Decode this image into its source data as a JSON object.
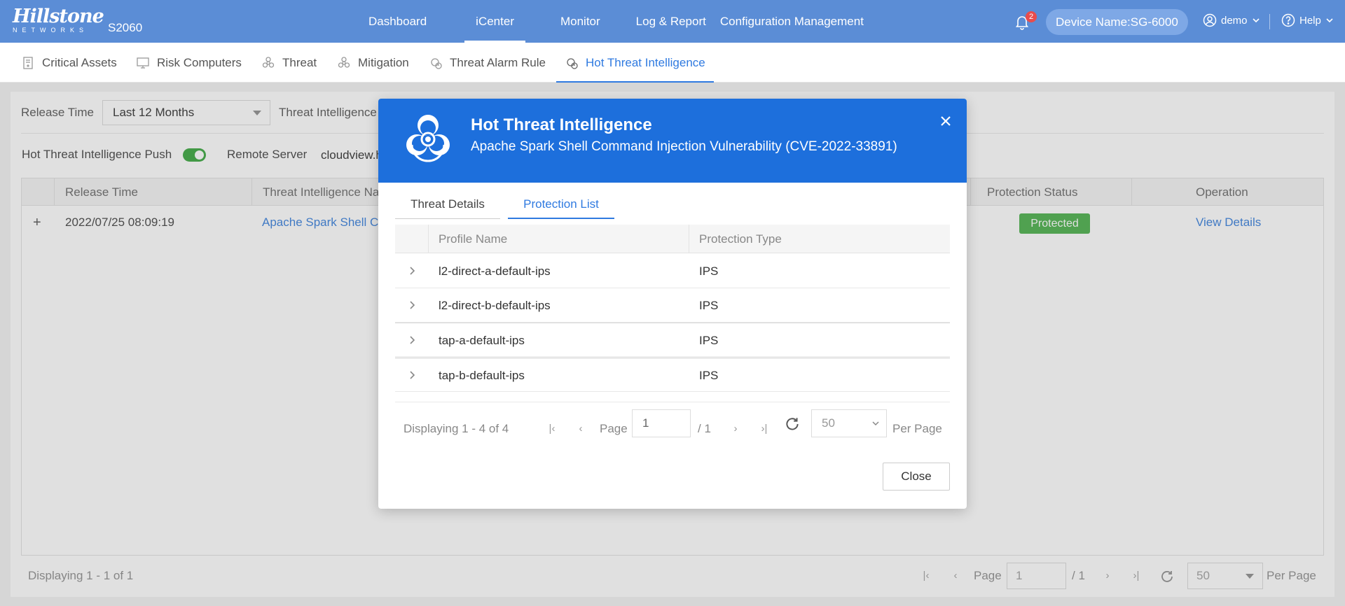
{
  "header": {
    "brand": "Hillstone",
    "brand_sub": "NETWORKS",
    "model": "S2060",
    "nav": [
      "Dashboard",
      "iCenter",
      "Monitor",
      "Log & Report",
      "Configuration Management"
    ],
    "active_nav": "iCenter",
    "notification_count": "2",
    "device_name": "Device Name:SG-6000",
    "user": "demo",
    "help": "Help",
    "colors": {
      "bar": "#5b8dd6",
      "badge": "#e84c4c"
    }
  },
  "subnav": {
    "tabs": [
      "Critical Assets",
      "Risk Computers",
      "Threat",
      "Mitigation",
      "Threat Alarm Rule",
      "Hot Threat Intelligence"
    ],
    "active": "Hot Threat Intelligence"
  },
  "filters": {
    "release_time_label": "Release Time",
    "release_time_value": "Last 12 Months",
    "threat_intel_label": "Threat Intelligence",
    "push_label": "Hot Threat Intelligence Push",
    "push_enabled": true,
    "remote_server_label": "Remote Server",
    "remote_server_value": "cloudview.h"
  },
  "grid": {
    "headers": [
      "Release Time",
      "Threat Intelligence Nar",
      "Protection Status",
      "Operation"
    ],
    "row": {
      "expand": "+",
      "release_time": "2022/07/25 08:09:19",
      "name": "Apache Spark Shell Co",
      "status": "Protected",
      "operation": "View Details"
    }
  },
  "bottom_pager": {
    "displaying": "Displaying 1 - 1 of 1",
    "page_label": "Page",
    "page_value": "1",
    "of_total": "/ 1",
    "per_page_value": "50",
    "per_page_label": "Per Page"
  },
  "modal": {
    "title": "Hot Threat Intelligence",
    "subtitle": "Apache Spark Shell Command Injection Vulnerability (CVE-2022-33891)",
    "tabs": [
      "Threat Details",
      "Protection List"
    ],
    "active_tab": "Protection List",
    "table_headers": [
      "Profile Name",
      "Protection Type"
    ],
    "rows": [
      {
        "profile": "l2-direct-a-default-ips",
        "type": "IPS"
      },
      {
        "profile": "l2-direct-b-default-ips",
        "type": "IPS"
      },
      {
        "profile": "tap-a-default-ips",
        "type": "IPS"
      },
      {
        "profile": "tap-b-default-ips",
        "type": "IPS"
      }
    ],
    "pager": {
      "displaying": "Displaying 1 - 4 of 4",
      "page_label": "Page",
      "page_value": "1",
      "of_total": "/ 1",
      "per_page_value": "50",
      "per_page_label": "Per Page"
    },
    "close_label": "Close",
    "colors": {
      "header": "#1d6fdc",
      "accent": "#2f7ae0",
      "protected": "#5cb85c"
    }
  }
}
